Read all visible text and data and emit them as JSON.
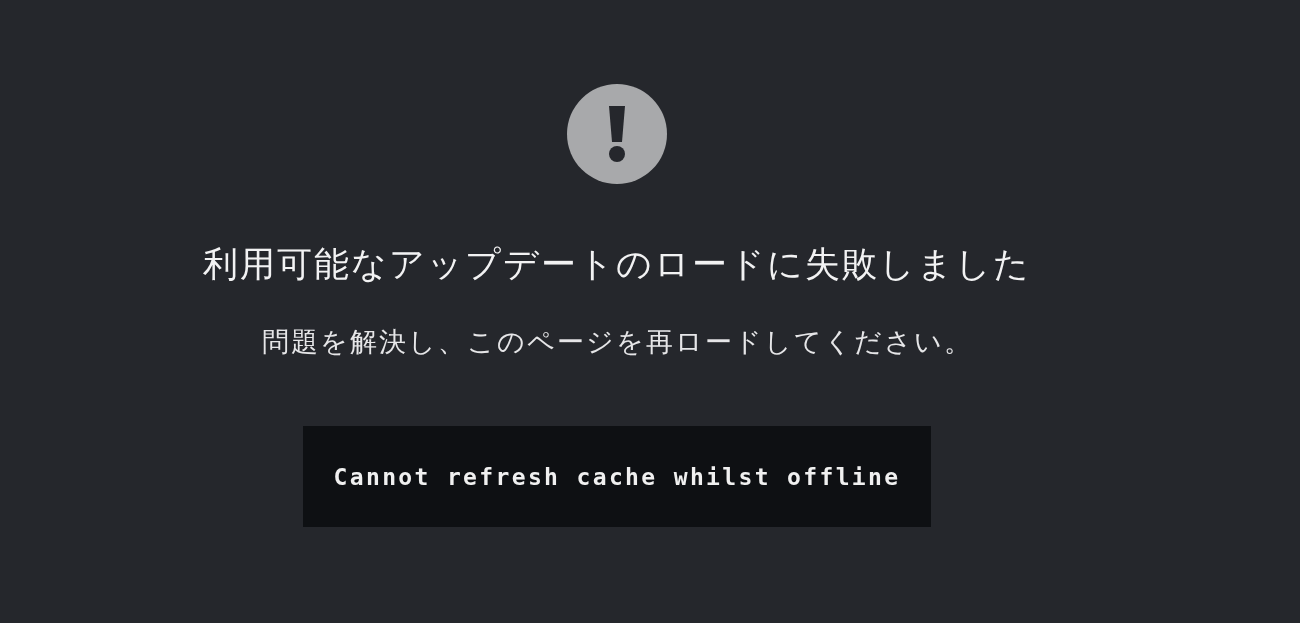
{
  "title": "利用可能なアップデートのロードに失敗しました",
  "message": "問題を解決し、このページを再ロードしてください。",
  "error_detail": "Cannot refresh cache whilst offline"
}
